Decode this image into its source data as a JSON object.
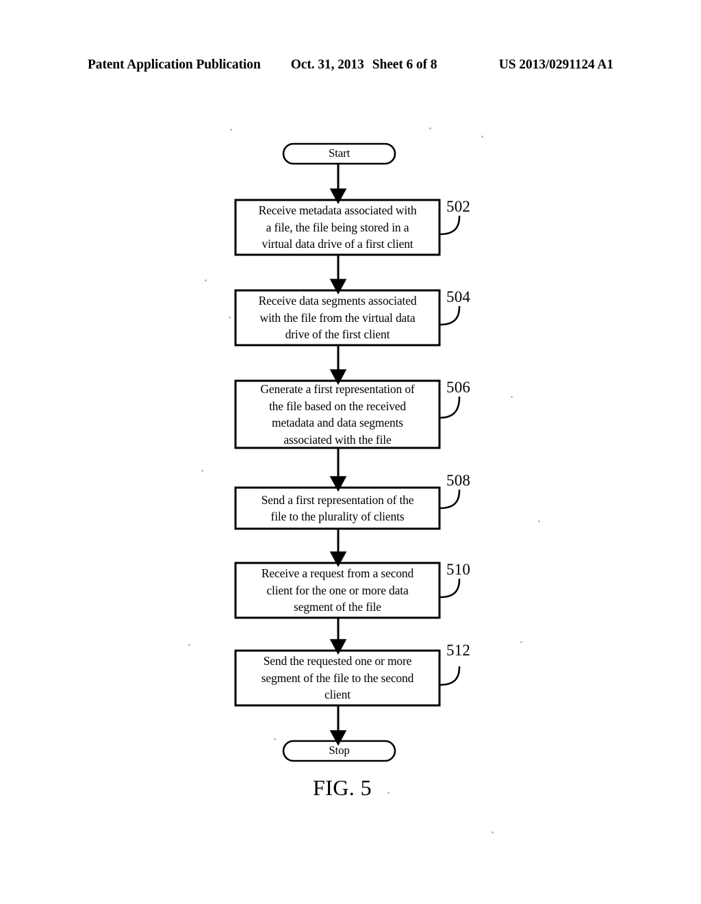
{
  "header": {
    "publication": "Patent Application Publication",
    "date": "Oct. 31, 2013",
    "sheet": "Sheet 6 of 8",
    "doc_number": "US 2013/0291124 A1"
  },
  "figure": {
    "caption": "FIG. 5",
    "ink_color": "#000000",
    "background_color": "#ffffff",
    "nodes": [
      {
        "id": "start",
        "type": "terminator",
        "label": "Start"
      },
      {
        "id": "step-502",
        "type": "process",
        "ref": "502",
        "label": "Receive metadata associated with\na file, the file being stored in a\nvirtual data drive of a first client"
      },
      {
        "id": "step-504",
        "type": "process",
        "ref": "504",
        "label": "Receive data segments associated\nwith the file from the virtual data\ndrive of the first client"
      },
      {
        "id": "step-506",
        "type": "process",
        "ref": "506",
        "label": "Generate a first representation of\nthe file based on the received\nmetadata and data segments\nassociated with the file"
      },
      {
        "id": "step-508",
        "type": "process",
        "ref": "508",
        "label": "Send a first representation of the\nfile to the plurality of clients"
      },
      {
        "id": "step-510",
        "type": "process",
        "ref": "510",
        "label": "Receive a request from a second\nclient for the one or more data\nsegment of the file"
      },
      {
        "id": "step-512",
        "type": "process",
        "ref": "512",
        "label": "Send the requested one or more\nsegment of the file to the second\nclient"
      },
      {
        "id": "stop",
        "type": "terminator",
        "label": "Stop"
      }
    ]
  }
}
